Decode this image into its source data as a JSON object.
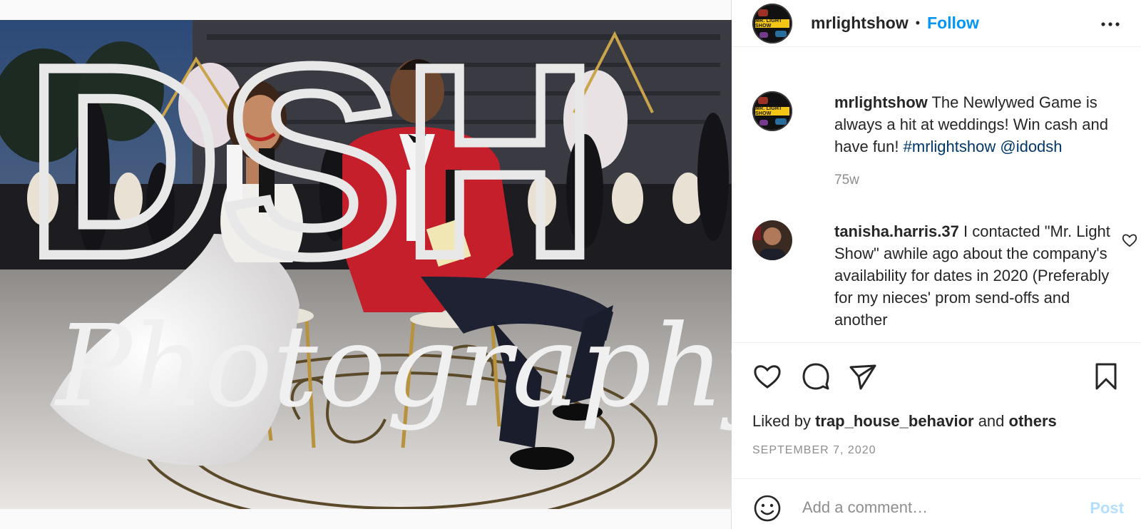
{
  "post": {
    "photo_alt": "Wedding couple seated holding bride and groom dolls",
    "watermark": {
      "line1": "DSH",
      "line2": "Photography"
    }
  },
  "header": {
    "avatar_icon": "mr-light-show-logo",
    "avatar_text": "MR. LIGHT SHOW",
    "username": "mrlightshow",
    "separator": "•",
    "follow_label": "Follow",
    "more_icon": "more-horizontal-icon"
  },
  "caption": {
    "username": "mrlightshow",
    "text": " The Newlywed Game is always a hit at weddings! Win cash and have fun! ",
    "tags": "#mrlightshow @idodsh",
    "time": "75w"
  },
  "comments": [
    {
      "username": "tanisha.harris.37",
      "text": " I contacted \"Mr. Light Show\" awhile ago about the company's availability for dates in 2020 (Preferably for my nieces' prom send-offs and another"
    }
  ],
  "actions": {
    "like_icon": "heart-icon",
    "comment_icon": "comment-icon",
    "share_icon": "paper-plane-icon",
    "save_icon": "bookmark-icon"
  },
  "likes": {
    "prefix": "Liked by ",
    "user": "trap_house_behavior",
    "middle": " and ",
    "suffix": "others"
  },
  "date": "SEPTEMBER 7, 2020",
  "add_comment": {
    "emoji_icon": "emoji-icon",
    "placeholder": "Add a comment…",
    "post_label": "Post"
  },
  "colors": {
    "follow": "#0095f6",
    "post_disabled": "#b2dffc",
    "tag": "#00376b",
    "muted": "#8e8e8e"
  }
}
